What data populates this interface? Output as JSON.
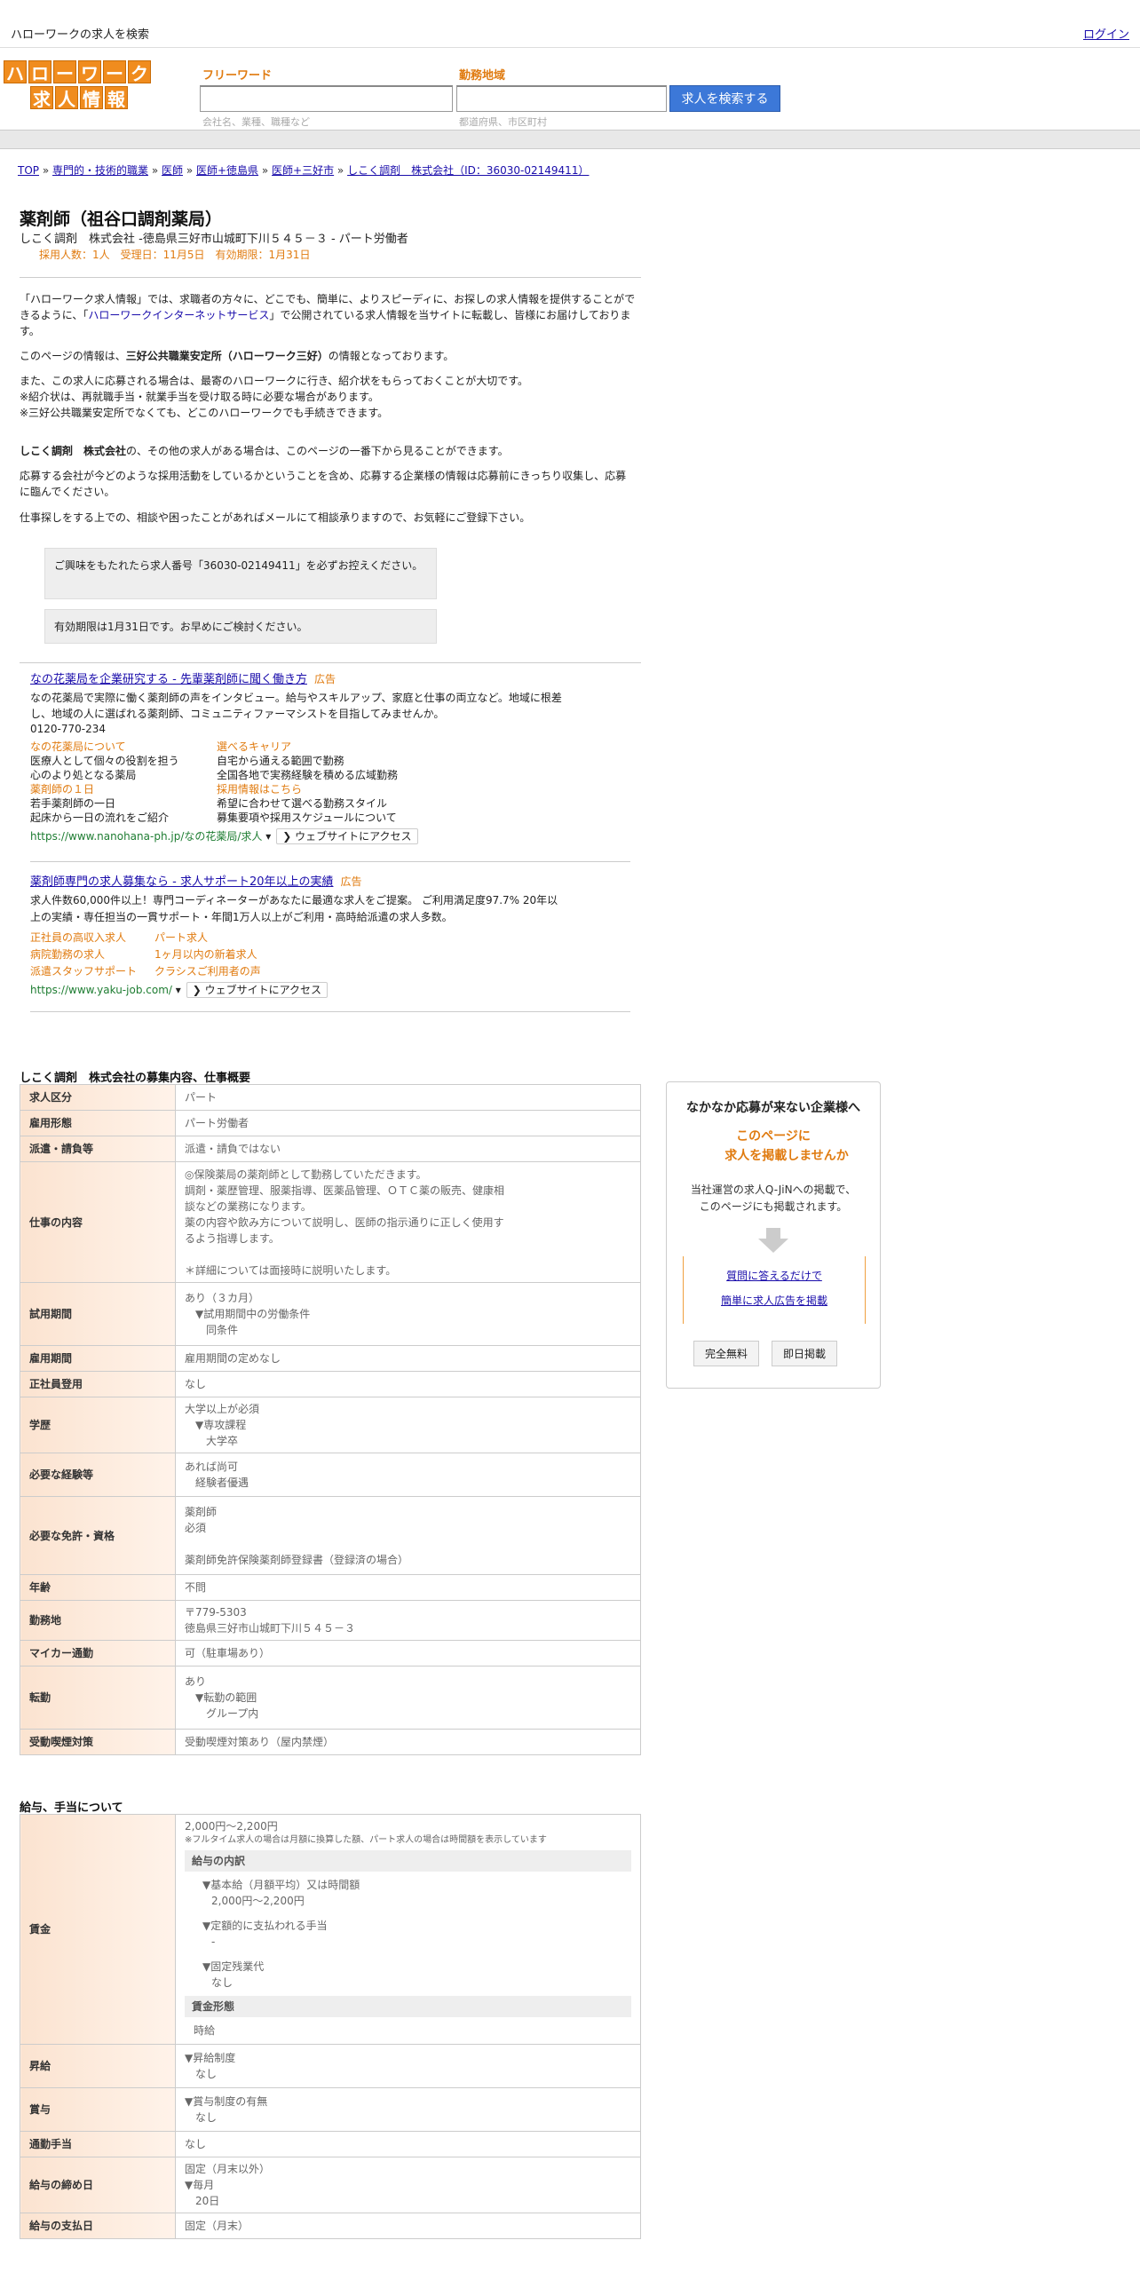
{
  "topbar": {
    "title": "ハローワークの求人を検索",
    "right_link": "ログイン"
  },
  "logo": {
    "row1": [
      "ハ",
      "ロ",
      "ー",
      "ワ",
      "ー",
      "ク"
    ],
    "row2": [
      "求",
      "人",
      "情",
      "報"
    ]
  },
  "search": {
    "freeword_label": "フリーワード",
    "freeword_placeholder": "会社名、業種、職種など",
    "area_label": "勤務地域",
    "area_placeholder": "都道府県、市区町村",
    "button": "求人を検索する"
  },
  "breadcrumb": {
    "items": [
      "TOP",
      "専門的・技術的職業",
      "医師",
      "医師+徳島県",
      "医師+三好市",
      "しこく調剤　株式会社（ID：36030-02149411）"
    ]
  },
  "job": {
    "title": "薬剤師（祖谷口調剤薬局）",
    "subtitle": "しこく調剤　株式会社 -徳島県三好市山城町下川５４５－３ - パート労働者",
    "meta": "採用人数：1人　受理日：11月5日　有効期限：1月31日"
  },
  "intro": {
    "p1a": "「ハローワーク求人情報」では、求職者の方々に、どこでも、簡単に、よりスピーディに、お探しの求人情報を提供することができるように、「",
    "p1link": "ハローワークインターネットサービス",
    "p1b": "」で公開されている求人情報を当サイトに転載し、皆様にお届けしております。",
    "p2a": "このページの情報は、",
    "p2b": "三好公共職業安定所（ハローワーク三好）",
    "p2c": "の情報となっております。",
    "p3": "また、この求人に応募される場合は、最寄のハローワークに行き、紹介状をもらっておくことが大切です。",
    "p4": "※紹介状は、再就職手当・就業手当を受け取る時に必要な場合があります。",
    "p5": "※三好公共職業安定所でなくても、どこのハローワークでも手続きできます。",
    "p6a": "しこく調剤　株式会社",
    "p6b": "の、その他の求人がある場合は、このページの一番下から見ることができます。",
    "p7": "応募する会社が今どのような採用活動をしているかということを含め、応募する企業様の情報は応募前にきっちり収集し、応募に臨んでください。",
    "p8": "仕事探しをする上での、相談や困ったことがあればメールにて相談承りますので、お気軽にご登録下さい。"
  },
  "notice": {
    "n1": "ご興味をもたれたら求人番号「36030-02149411」を必ずお控えください。",
    "n2": "有効期限は1月31日です。お早めにご検討ください。"
  },
  "ad1": {
    "title": "なの花薬局を企業研究する - 先輩薬剤師に聞く働き方",
    "tag": "広告",
    "desc": "なの花薬局で実際に働く薬剤師の声をインタビュー。給与やスキルアップ、家庭と仕事の両立など。地域に根差し、地域の人に選ばれる薬剤師、コミュニティファーマシストを目指してみませんか。",
    "phone": "0120-770-234",
    "links": [
      {
        "t": "なの花薬局について",
        "d1": "医療人として個々の役割を担う",
        "d2": "心のより処となる薬局"
      },
      {
        "t": "選べるキャリア",
        "d1": "自宅から通える範囲で勤務",
        "d2": "全国各地で実務経験を積める広域勤務"
      },
      {
        "t": "薬剤師の１日",
        "d1": "若手薬剤師の一日",
        "d2": "起床から一日の流れをご紹介"
      },
      {
        "t": "採用情報はこちら",
        "d1": "希望に合わせて選べる勤務スタイル",
        "d2": "募集要項や採用スケジュールについて"
      }
    ],
    "url": "https://www.nanohana-ph.jp/なの花薬局/求人",
    "cta": "❯ ウェブサイトにアクセス"
  },
  "ad2": {
    "title": "薬剤師専門の求人募集なら - 求人サポート20年以上の実績",
    "tag": "広告",
    "desc": "求人件数60,000件以上！専門コーディネーターがあなたに最適な求人をご提案。 ご利用満足度97.7% 20年以上の実績・専任担当の一貫サポート・年間1万人以上がご利用・高時給派遣の求人多数。",
    "links": [
      "正社員の高収入求人",
      "パート求人",
      "病院勤務の求人",
      "1ヶ月以内の新着求人",
      "派遣スタッフサポート",
      "クラシスご利用者の声"
    ],
    "url": "https://www.yaku-job.com/",
    "cta": "❯ ウェブサイトにアクセス"
  },
  "section1": {
    "title": "しこく調剤　株式会社の募集内容、仕事概要",
    "rows": [
      {
        "h": "求人区分",
        "v": [
          "パート"
        ]
      },
      {
        "h": "雇用形態",
        "v": [
          "パート労働者"
        ]
      },
      {
        "h": "派遣・請負等",
        "v": [
          "派遣・請負ではない"
        ]
      },
      {
        "h": "仕事の内容",
        "v": [
          "◎保険薬局の薬剤師として勤務していただきます。",
          "調剤・薬歴管理、服薬指導、医薬品管理、ＯＴＣ薬の販売、健康相",
          "談などの業務になります。",
          "薬の内容や飲み方について説明し、医師の指示通りに正しく使用す",
          "るよう指導します。",
          "",
          "＊詳細については面接時に説明いたします。"
        ]
      },
      {
        "h": "試用期間",
        "v": [
          "あり（３カ月）",
          "　▼試用期間中の労働条件",
          "　　同条件"
        ]
      },
      {
        "h": "雇用期間",
        "v": [
          "雇用期間の定めなし"
        ]
      },
      {
        "h": "正社員登用",
        "v": [
          "なし"
        ]
      },
      {
        "h": "学歴",
        "v": [
          "大学以上が必須",
          "　▼専攻課程",
          "　　大学卒"
        ]
      },
      {
        "h": "必要な経験等",
        "v": [
          "あれば尚可",
          "　経験者優遇"
        ]
      },
      {
        "h": "必要な免許・資格",
        "v": [
          "薬剤師",
          "必須",
          "",
          "薬剤師免許保険薬剤師登録書（登録済の場合）"
        ]
      },
      {
        "h": "年齢",
        "v": [
          "不問"
        ]
      },
      {
        "h": "勤務地",
        "v": [
          "〒779-5303",
          "徳島県三好市山城町下川５４５－３"
        ]
      },
      {
        "h": "マイカー通勤",
        "v": [
          "可（駐車場あり）"
        ]
      },
      {
        "h": "転勤",
        "v": [
          "あり",
          "　▼転勤の範囲",
          "　　グループ内"
        ]
      },
      {
        "h": "受動喫煙対策",
        "v": [
          "受動喫煙対策あり（屋内禁煙）"
        ]
      }
    ]
  },
  "section2": {
    "title": "給与、手当について",
    "wage": {
      "h": "賃金",
      "range": "2,000円〜2,200円",
      "note": "※フルタイム求人の場合は月額に換算した額、パート求人の場合は時間額を表示しています",
      "sub1": "給与の内訳",
      "l1": "▼基本給（月額平均）又は時間額",
      "l1v": "2,000円〜2,200円",
      "l2": "▼定額的に支払われる手当",
      "l2v": "-",
      "l3": "▼固定残業代",
      "l3v": "なし",
      "sub2": "賃金形態",
      "form": "時給"
    },
    "rows": [
      {
        "h": "昇給",
        "v": [
          "▼昇給制度",
          "　なし"
        ]
      },
      {
        "h": "賞与",
        "v": [
          "▼賞与制度の有無",
          "　なし"
        ]
      },
      {
        "h": "通勤手当",
        "v": [
          "なし"
        ]
      },
      {
        "h": "給与の締め日",
        "v": [
          "固定（月末以外）",
          "▼毎月",
          "　20日"
        ]
      },
      {
        "h": "給与の支払日",
        "v": [
          "固定（月末）"
        ]
      }
    ]
  },
  "side": {
    "a": "なかなか応募が来ない企業様へ",
    "b1": "このページに",
    "b2": "求人を掲載しませんか",
    "c1": "当社運営の求人Q-JiNへの掲載で、",
    "c2": "このページにも掲載されます。",
    "d1": "質問に答えるだけで",
    "d2": "簡単に求人広告を掲載",
    "e1": "完全無料",
    "e2": "即日掲載"
  }
}
